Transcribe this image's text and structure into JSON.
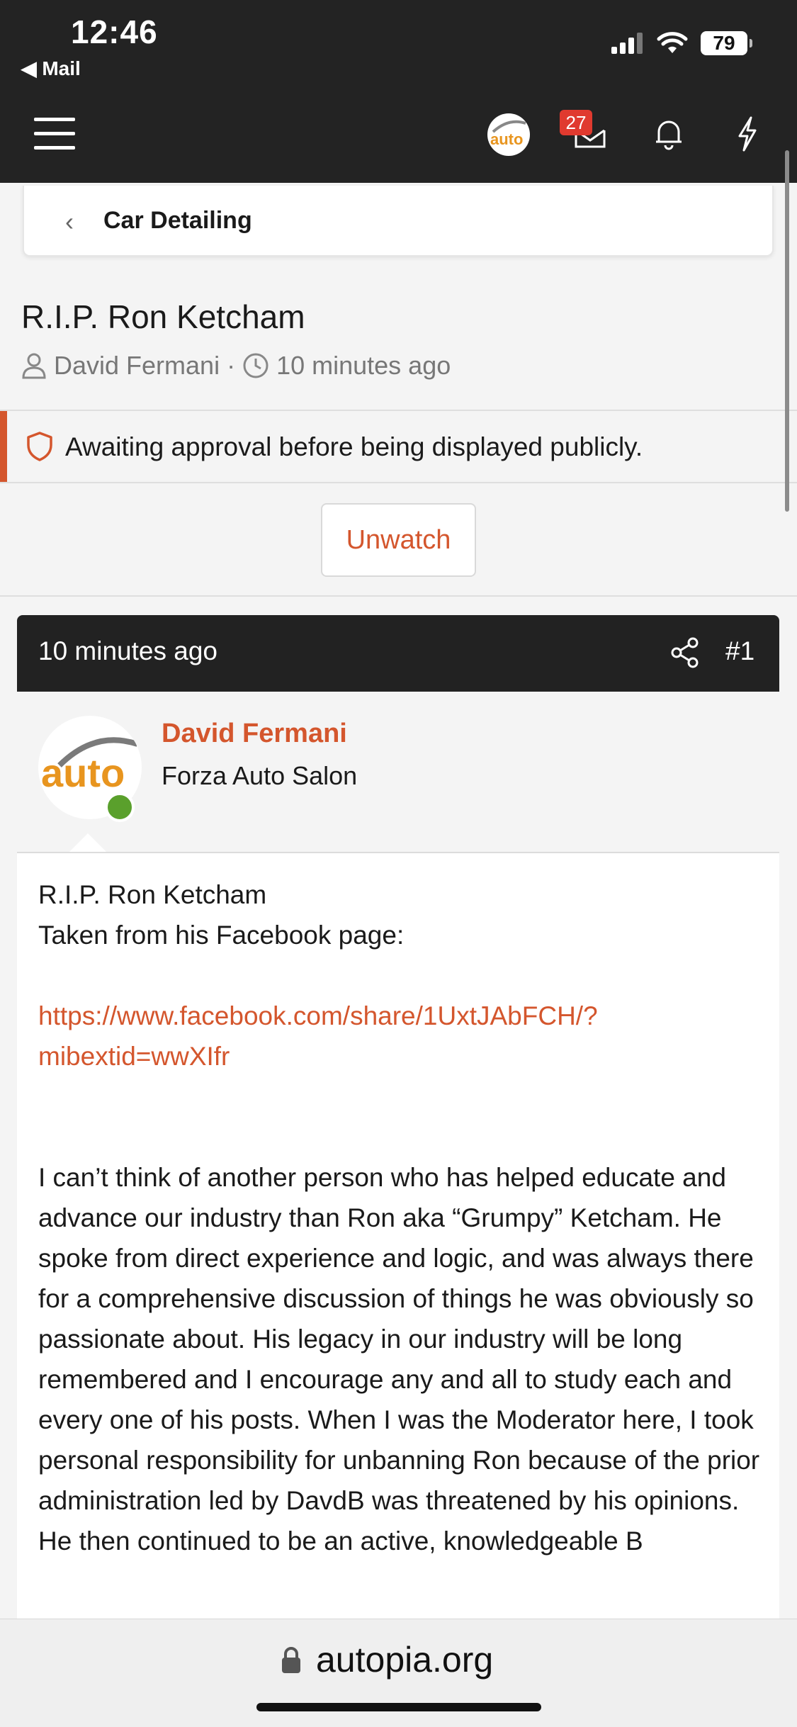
{
  "status_bar": {
    "time": "12:46",
    "back_app": "◀ Mail",
    "battery": "79"
  },
  "header": {
    "mail_badge": "27"
  },
  "breadcrumb": {
    "label": "Car Detailing"
  },
  "thread": {
    "title": "R.I.P. Ron Ketcham",
    "author": "David Fermani",
    "separator": "·",
    "time": "10 minutes ago"
  },
  "approval": {
    "text": "Awaiting approval before being displayed publicly."
  },
  "watch": {
    "label": "Unwatch"
  },
  "post": {
    "time": "10 minutes ago",
    "number": "#1",
    "author_name": "David Fermani",
    "author_title": "Forza Auto Salon",
    "line1": "R.I.P. Ron Ketcham",
    "line2": "Taken from his Facebook page:",
    "link": "https://www.facebook.com/share/1UxtJAbFCH/?mibextid=wwXIfr",
    "paragraph": "I can’t think of another person who has helped educate and advance our industry than Ron aka “Grumpy” Ketcham. He spoke from direct experience and logic, and was always there for a comprehensive discussion of things he was obviously so passionate about. His legacy in our industry will be long remembered and I encourage any and all to study each and every one of his posts. When I was the Moderator here, I took personal responsibility for unbanning Ron because of the prior administration led by DavdB was threatened by his opinions. He then continued to be an active, knowledgeable B"
  },
  "browser": {
    "url": "autopia.org"
  },
  "colors": {
    "accent": "#d4562d",
    "header_bg": "#232323",
    "online": "#5aa02c",
    "badge": "#e03a2f"
  }
}
